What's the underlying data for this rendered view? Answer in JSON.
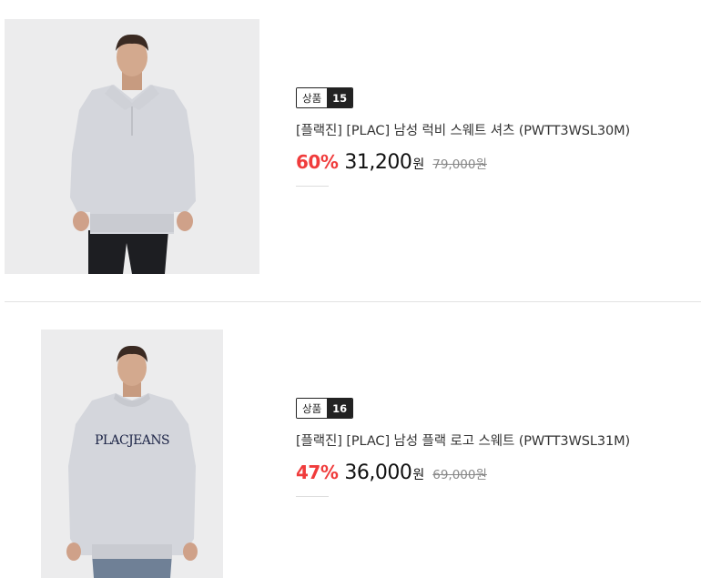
{
  "products": [
    {
      "badge_label": "상품",
      "badge_number": "15",
      "title": "[플랙진] [PLAC] 남성 럭비 스웨트 셔츠 (PWTT3WSL30M)",
      "discount": "60%",
      "sale_price": "31,200",
      "sale_unit": "원",
      "original_price": "79,000원",
      "image_label": "model wearing grey rugby sweat shirt"
    },
    {
      "badge_label": "상품",
      "badge_number": "16",
      "title": "[플랙진] [PLAC] 남성 플랙 로고 스웨트 (PWTT3WSL31M)",
      "discount": "47%",
      "sale_price": "36,000",
      "sale_unit": "원",
      "original_price": "69,000원",
      "image_label": "model wearing grey logo sweatshirt",
      "shirt_print": "PLACJEANS"
    }
  ],
  "colors": {
    "discount": "#f03c3c",
    "badge_dark": "#222222",
    "sweat_grey": "#d4d6dc"
  }
}
